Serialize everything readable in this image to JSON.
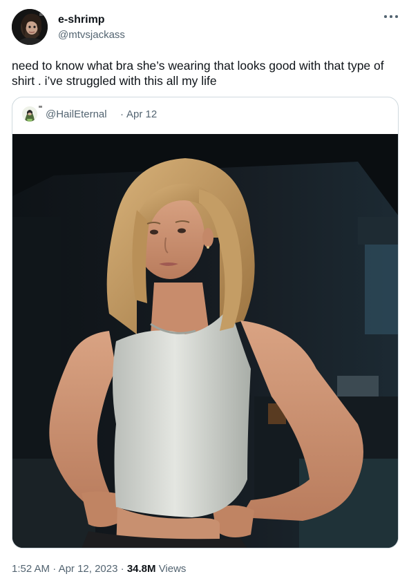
{
  "author": {
    "name": "e-shrimp",
    "handle": "@mtvsjackass"
  },
  "tweet": {
    "text": "need to know what bra she’s wearing that looks good with that type of shirt . i’ve struggled with this all my life",
    "time": "1:52 AM",
    "separator": "·",
    "date": "Apr 12, 2023",
    "views_count": "34.8M",
    "views_label": "Views"
  },
  "quoted": {
    "handle": "@HailEternal",
    "separator": "·",
    "date": "Apr 12"
  },
  "icons": {
    "more": "more-horizontal-icon"
  },
  "colors": {
    "text_primary": "#0f1419",
    "text_secondary": "#536471",
    "border": "#cfd9de",
    "background": "#ffffff"
  }
}
